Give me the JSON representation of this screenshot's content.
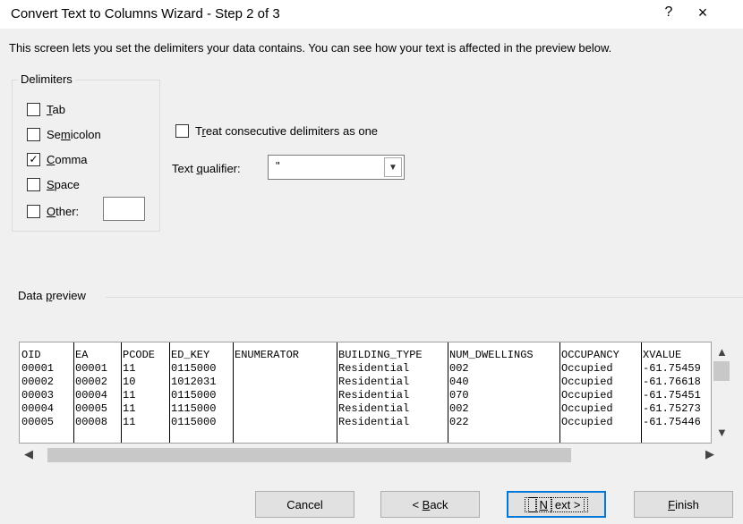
{
  "window": {
    "title": "Convert Text to Columns Wizard - Step 2 of 3",
    "help": "?",
    "close": "×"
  },
  "intro": "This screen lets you set the delimiters your data contains.  You can see how your text is affected in the preview below.",
  "delimiters": {
    "legend": "Delimiters",
    "items": [
      {
        "pre": "",
        "key": "T",
        "post": "ab",
        "checked": false
      },
      {
        "pre": "Se",
        "key": "m",
        "post": "icolon",
        "checked": false
      },
      {
        "pre": "",
        "key": "C",
        "post": "omma",
        "checked": true
      },
      {
        "pre": "",
        "key": "S",
        "post": "pace",
        "checked": false
      },
      {
        "pre": "",
        "key": "O",
        "post": "ther:",
        "checked": false
      }
    ],
    "other_value": ""
  },
  "consecutive": {
    "pre": "T",
    "key": "r",
    "post": "eat consecutive delimiters as one",
    "checked": false
  },
  "qualifier": {
    "pre": "Text ",
    "key": "q",
    "post": "ualifier:",
    "value": "\""
  },
  "preview": {
    "label_pre": "Data ",
    "label_key": "p",
    "label_post": "review",
    "headers": [
      "OID",
      "EA",
      "PCODE",
      "ED_KEY",
      "ENUMERATOR",
      "BUILDING_TYPE",
      "NUM_DWELLINGS",
      "OCCUPANCY",
      "XVALUE"
    ],
    "rows": [
      [
        "00001",
        "00001",
        "11",
        "0115000",
        "",
        "Residential",
        "002",
        "Occupied",
        "-61.75459"
      ],
      [
        "00002",
        "00002",
        "10",
        "1012031",
        "",
        "Residential",
        "040",
        "Occupied",
        "-61.76618"
      ],
      [
        "00003",
        "00004",
        "11",
        "0115000",
        "",
        "Residential",
        "070",
        "Occupied",
        "-61.75451"
      ],
      [
        "00004",
        "00005",
        "11",
        "1115000",
        "",
        "Residential",
        "002",
        "Occupied",
        "-61.75273"
      ],
      [
        "00005",
        "00008",
        "11",
        "0115000",
        "",
        "Residential",
        "022",
        "Occupied",
        "-61.75446"
      ]
    ]
  },
  "buttons": {
    "cancel": "Cancel",
    "back": {
      "pre": "< ",
      "key": "B",
      "post": "ack"
    },
    "next": {
      "pre": "",
      "key": "N",
      "post": "ext >"
    },
    "finish": {
      "pre": "",
      "key": "F",
      "post": "inish"
    }
  },
  "icons": {
    "scroll_up": "chevron-up-icon",
    "scroll_down": "chevron-down-icon",
    "scroll_left": "chevron-left-icon",
    "scroll_right": "chevron-right-icon",
    "dropdown": "chevron-down-icon",
    "check": "checkmark-icon"
  }
}
